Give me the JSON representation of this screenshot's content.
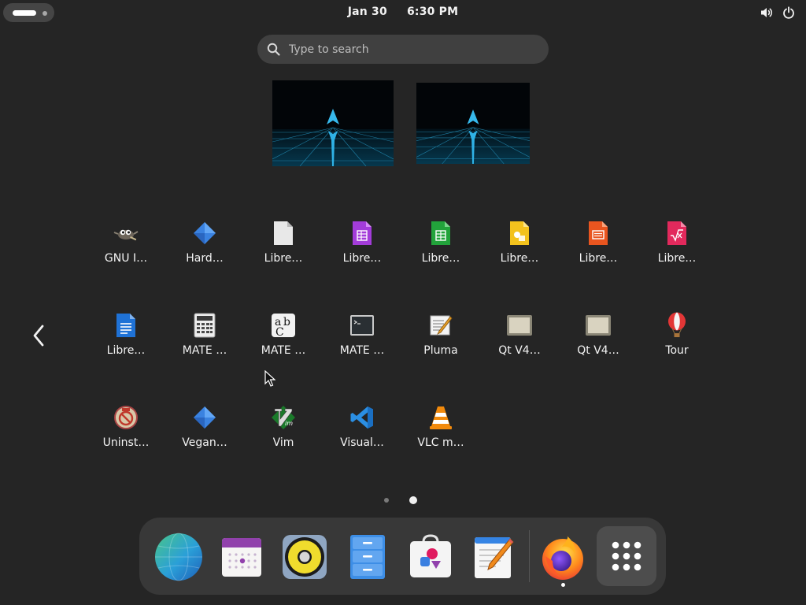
{
  "topbar": {
    "date": "Jan 30",
    "time": "6:30 PM",
    "icons": [
      "activities-indicator",
      "volume-icon",
      "power-icon"
    ]
  },
  "search": {
    "placeholder": "Type to search",
    "value": ""
  },
  "workspaces": [
    "workspace-1",
    "workspace-2"
  ],
  "apps": [
    {
      "label": "GNU I…",
      "icon": "gimp-icon"
    },
    {
      "label": "Hard…",
      "icon": "hardinfo-icon"
    },
    {
      "label": "Libre…",
      "icon": "libreoffice-icon"
    },
    {
      "label": "Libre…",
      "icon": "libreoffice-base-icon"
    },
    {
      "label": "Libre…",
      "icon": "libreoffice-calc-icon"
    },
    {
      "label": "Libre…",
      "icon": "libreoffice-draw-icon"
    },
    {
      "label": "Libre…",
      "icon": "libreoffice-impress-icon"
    },
    {
      "label": "Libre…",
      "icon": "libreoffice-math-icon"
    },
    {
      "label": "Libre…",
      "icon": "libreoffice-writer-icon"
    },
    {
      "label": "MATE …",
      "icon": "calculator-icon"
    },
    {
      "label": "MATE …",
      "icon": "character-map-icon"
    },
    {
      "label": "MATE …",
      "icon": "terminal-icon"
    },
    {
      "label": "Pluma",
      "icon": "pluma-icon"
    },
    {
      "label": "Qt V4…",
      "icon": "qt-v4l-icon"
    },
    {
      "label": "Qt V4…",
      "icon": "qt-v4l-icon"
    },
    {
      "label": "Tour",
      "icon": "tour-balloon-icon"
    },
    {
      "label": "Uninst…",
      "icon": "uninstall-icon"
    },
    {
      "label": "Vegan…",
      "icon": "vegan-icon"
    },
    {
      "label": "Vim",
      "icon": "vim-icon"
    },
    {
      "label": "Visual…",
      "icon": "vscode-icon"
    },
    {
      "label": "VLC m…",
      "icon": "vlc-icon"
    }
  ],
  "pager": {
    "pages": 2,
    "current": 2
  },
  "dock": [
    {
      "name": "web-browser-icon"
    },
    {
      "name": "calendar-icon"
    },
    {
      "name": "rhythmbox-speaker-icon"
    },
    {
      "name": "files-cabinet-icon"
    },
    {
      "name": "software-store-icon"
    },
    {
      "name": "text-editor-icon"
    },
    {
      "name": "firefox-icon",
      "running": true
    },
    {
      "name": "show-apps-grid-icon"
    }
  ]
}
